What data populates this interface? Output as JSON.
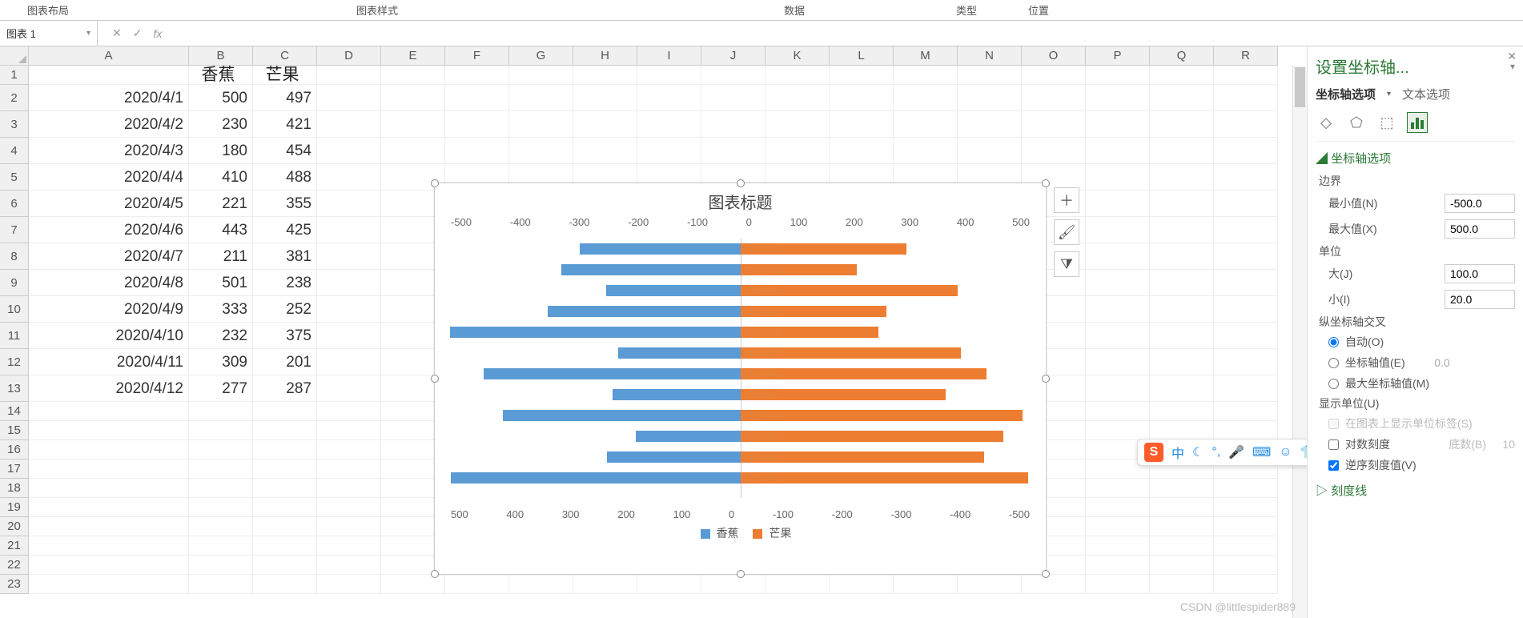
{
  "ribbon": {
    "layout": "图表布局",
    "style": "图表样式",
    "data": "数据",
    "type": "类型",
    "position": "位置"
  },
  "formula_bar": {
    "name_box": "图表 1",
    "cancel": "✕",
    "confirm": "✓",
    "fx": "fx"
  },
  "sheet": {
    "col_letters": [
      "A",
      "B",
      "C",
      "D",
      "E",
      "F",
      "G",
      "H",
      "I",
      "J",
      "K",
      "L",
      "M",
      "N",
      "O",
      "P",
      "Q",
      "R"
    ],
    "row_numbers": [
      1,
      2,
      3,
      4,
      5,
      6,
      7,
      8,
      9,
      10,
      11,
      12,
      13,
      14,
      15,
      16,
      17,
      18,
      19,
      20,
      21,
      22,
      23
    ],
    "header": {
      "b": "香蕉",
      "c": "芒果"
    },
    "data": [
      {
        "a": "2020/4/1",
        "b": "500",
        "c": "497"
      },
      {
        "a": "2020/4/2",
        "b": "230",
        "c": "421"
      },
      {
        "a": "2020/4/3",
        "b": "180",
        "c": "454"
      },
      {
        "a": "2020/4/4",
        "b": "410",
        "c": "488"
      },
      {
        "a": "2020/4/5",
        "b": "221",
        "c": "355"
      },
      {
        "a": "2020/4/6",
        "b": "443",
        "c": "425"
      },
      {
        "a": "2020/4/7",
        "b": "211",
        "c": "381"
      },
      {
        "a": "2020/4/8",
        "b": "501",
        "c": "238"
      },
      {
        "a": "2020/4/9",
        "b": "333",
        "c": "252"
      },
      {
        "a": "2020/4/10",
        "b": "232",
        "c": "375"
      },
      {
        "a": "2020/4/11",
        "b": "309",
        "c": "201"
      },
      {
        "a": "2020/4/12",
        "b": "277",
        "c": "287"
      }
    ]
  },
  "chart_data": {
    "type": "bar",
    "title": "图表标题",
    "orientation": "horizontal",
    "categories": [
      "2020/4/1",
      "2020/4/2",
      "2020/4/3",
      "2020/4/4",
      "2020/4/5",
      "2020/4/6",
      "2020/4/7",
      "2020/4/8",
      "2020/4/9",
      "2020/4/10",
      "2020/4/11",
      "2020/4/12"
    ],
    "series": [
      {
        "name": "香蕉",
        "color": "#5b9bd5",
        "values": [
          -500,
          -230,
          -180,
          -410,
          -221,
          -443,
          -211,
          -501,
          -333,
          -232,
          -309,
          -277
        ]
      },
      {
        "name": "芒果",
        "color": "#ed7d31",
        "values": [
          497,
          421,
          454,
          488,
          355,
          425,
          381,
          238,
          252,
          375,
          201,
          287
        ]
      }
    ],
    "xlim_primary": [
      -500,
      500
    ],
    "xlim_secondary": [
      -500,
      500
    ],
    "top_axis_ticks": [
      "-500",
      "-400",
      "-300",
      "-200",
      "-100",
      "0",
      "100",
      "200",
      "300",
      "400",
      "500"
    ],
    "bottom_axis_ticks": [
      "500",
      "400",
      "300",
      "200",
      "100",
      "0",
      "-100",
      "-200",
      "-300",
      "-400",
      "-500"
    ],
    "reverse_secondary": true,
    "legend": [
      "香蕉",
      "芒果"
    ]
  },
  "chart_side_buttons": {
    "add": "＋",
    "brush": "🖌",
    "filter": "⧩"
  },
  "side_panel": {
    "title": "设置坐标轴...",
    "tab_axis": "坐标轴选项",
    "tab_text": "文本选项",
    "section_axis_options": "坐标轴选项",
    "bounds": "边界",
    "min_label": "最小值(N)",
    "min_value": "-500.0",
    "max_label": "最大值(X)",
    "max_value": "500.0",
    "units": "单位",
    "major_label": "大(J)",
    "major_value": "100.0",
    "minor_label": "小(I)",
    "minor_value": "20.0",
    "vertical_cross": "纵坐标轴交叉",
    "cross_auto": "自动(O)",
    "cross_value": "坐标轴值(E)",
    "cross_value_num": "0.0",
    "cross_max": "最大坐标轴值(M)",
    "display_unit": "显示单位(U)",
    "show_unit_label": "在图表上显示单位标签(S)",
    "log_scale": "对数刻度",
    "log_base_label": "底数(B)",
    "log_base_value": "10",
    "reverse": "逆序刻度值(V)",
    "tick_marks": "刻度线"
  },
  "ime": {
    "zhong": "中"
  },
  "watermark": "CSDN @littlespider889"
}
